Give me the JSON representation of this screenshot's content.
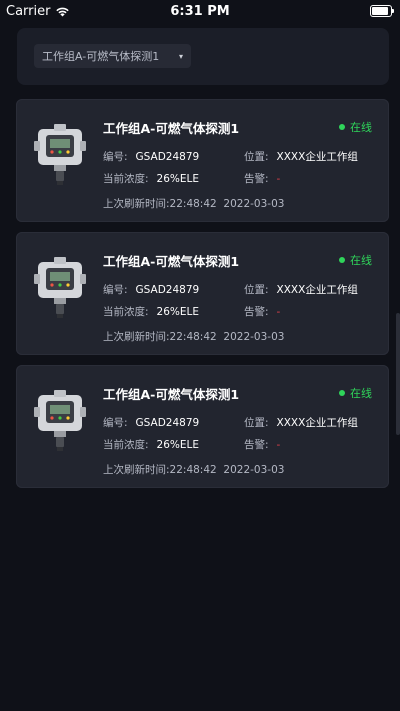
{
  "status_bar": {
    "carrier": "Carrier",
    "time": "6:31 PM"
  },
  "selector": {
    "value": "工作组A-可燃气体探测1",
    "arrow": "▾"
  },
  "labels": {
    "id": "编号:",
    "location": "位置:",
    "concentration": "当前浓度:",
    "alarm": "告警:",
    "refresh": "上次刷新时间:"
  },
  "devices": [
    {
      "name": "工作组A-可燃气体探测1",
      "status": "在线",
      "id": "GSAD24879",
      "location": "XXXX企业工作组",
      "concentration": "26%ELE",
      "alarm": "-",
      "refresh_time": "22:48:42",
      "refresh_date": "2022-03-03"
    },
    {
      "name": "工作组A-可燃气体探测1",
      "status": "在线",
      "id": "GSAD24879",
      "location": "XXXX企业工作组",
      "concentration": "26%ELE",
      "alarm": "-",
      "refresh_time": "22:48:42",
      "refresh_date": "2022-03-03"
    },
    {
      "name": "工作组A-可燃气体探测1",
      "status": "在线",
      "id": "GSAD24879",
      "location": "XXXX企业工作组",
      "concentration": "26%ELE",
      "alarm": "-",
      "refresh_time": "22:48:42",
      "refresh_date": "2022-03-03"
    }
  ],
  "colors": {
    "online": "#2fd45a",
    "alarm": "#e0404a",
    "card": "#22252f",
    "background": "#0f1118"
  }
}
